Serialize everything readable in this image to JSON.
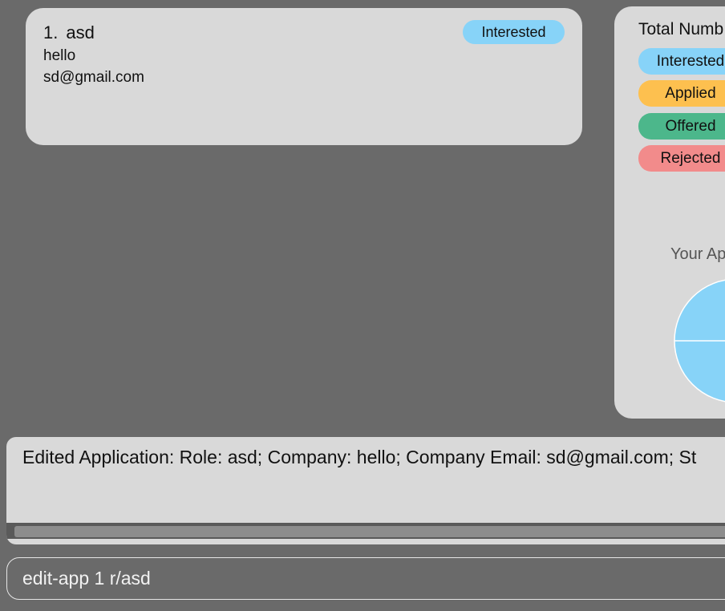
{
  "applications": [
    {
      "index": "1.",
      "role": "asd",
      "company": "hello",
      "email": "sd@gmail.com",
      "status": "Interested",
      "status_color": "#87d3f8"
    }
  ],
  "stats": {
    "heading": "Total Numb",
    "items": [
      {
        "label": "Interested",
        "color": "#87d3f8"
      },
      {
        "label": "Applied",
        "color": "#fdc04f"
      },
      {
        "label": "Offered",
        "color": "#4cb78b"
      },
      {
        "label": "Rejected",
        "color": "#f28b8b"
      }
    ],
    "chart_title": "Your Ap"
  },
  "chart_data": {
    "type": "pie",
    "title": "Your Ap",
    "slices": [
      {
        "label": "Interested",
        "value": 1,
        "color": "#87d3f8"
      }
    ]
  },
  "result": {
    "text": "Edited Application: Role: asd; Company: hello; Company Email: sd@gmail.com; St"
  },
  "command": {
    "value": "edit-app 1 r/asd"
  }
}
